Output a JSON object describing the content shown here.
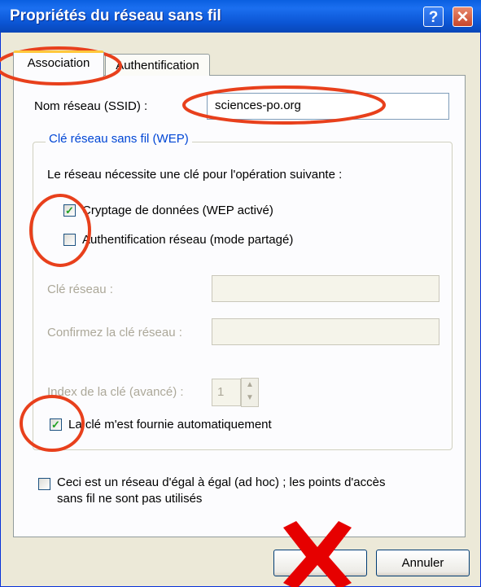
{
  "window": {
    "title": "Propriétés du réseau sans fil",
    "help_glyph": "?",
    "close_glyph": "✕"
  },
  "tabs": [
    {
      "label": "Association",
      "selected": true
    },
    {
      "label": "Authentification",
      "selected": false
    }
  ],
  "ssid": {
    "label": "Nom réseau (SSID) :",
    "value": "sciences-po.org"
  },
  "wep_group": {
    "legend": "Clé réseau sans fil (WEP)",
    "intro": "Le réseau nécessite une clé pour l'opération suivante :",
    "encryption": {
      "label": "Cryptage de données (WEP activé)",
      "checked": true
    },
    "shared_auth": {
      "label": "Authentification réseau (mode partagé)",
      "checked": false
    },
    "network_key": {
      "label": "Clé réseau :",
      "value": ""
    },
    "confirm_key": {
      "label": "Confirmez la clé réseau :",
      "value": ""
    },
    "key_index": {
      "label": "Index de la clé (avancé) :",
      "value": "1"
    },
    "auto_key": {
      "label": "La clé m'est fournie automatiquement",
      "checked": true
    }
  },
  "adhoc": {
    "line1": "Ceci est un réseau d'égal à égal (ad hoc) ; les points d'accès",
    "line2": "sans fil ne sont pas utilisés",
    "checked": false
  },
  "buttons": {
    "ok_label": "",
    "cancel_label": "Annuler"
  },
  "annotations": {
    "circle_color": "#e8401c",
    "cross_color": "#e60000"
  },
  "colors": {
    "titlebar": "#0b55d4",
    "dialog_bg": "#ece9d8",
    "group_legend": "#0046d5",
    "check_green": "#21a121"
  }
}
